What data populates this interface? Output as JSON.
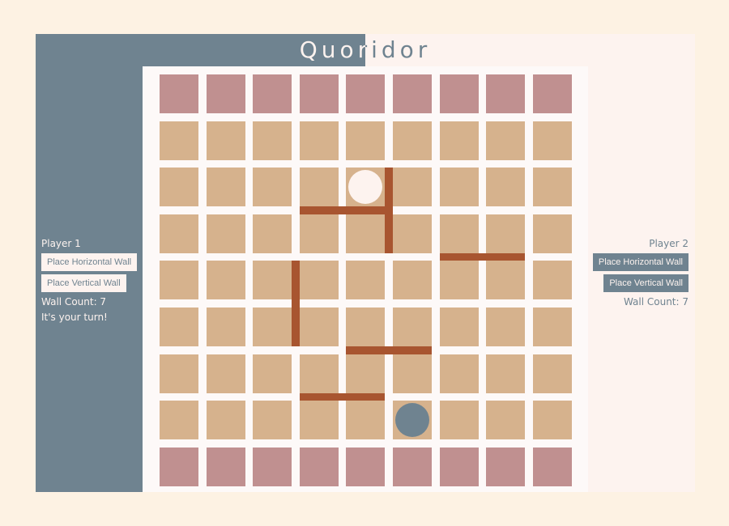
{
  "title": "Quoridor",
  "colors": {
    "player1": "#6f8390",
    "player2": "#fdf3ef",
    "cell": "#d6b28d",
    "goal_row": "#c09090",
    "wall": "#a85530",
    "board_bg": "#fdf9f8",
    "page_bg": "#fdf2e3"
  },
  "player1": {
    "name": "Player 1",
    "horizontal_button": "Place Horizontal Wall",
    "vertical_button": "Place Vertical Wall",
    "wall_count": "Wall Count: 7",
    "turn_message": "It's your turn!"
  },
  "player2": {
    "name": "Player 2",
    "horizontal_button": "Place Horizontal Wall",
    "vertical_button": "Place Vertical Wall",
    "wall_count": "Wall Count: 7"
  },
  "board": {
    "size": 9,
    "goal_rows": [
      0,
      8
    ],
    "pawns": [
      {
        "name": "pawn-player-2-light",
        "row": 2,
        "col": 4
      },
      {
        "name": "pawn-player-1-dark",
        "row": 7,
        "col": 5
      }
    ],
    "walls": [
      {
        "orientation": "horizontal",
        "row": 2,
        "col": 3
      },
      {
        "orientation": "vertical",
        "row": 2,
        "col": 5
      },
      {
        "orientation": "horizontal",
        "row": 3,
        "col": 6
      },
      {
        "orientation": "vertical",
        "row": 4,
        "col": 3
      },
      {
        "orientation": "horizontal",
        "row": 5,
        "col": 4
      },
      {
        "orientation": "horizontal",
        "row": 6,
        "col": 3
      }
    ]
  }
}
